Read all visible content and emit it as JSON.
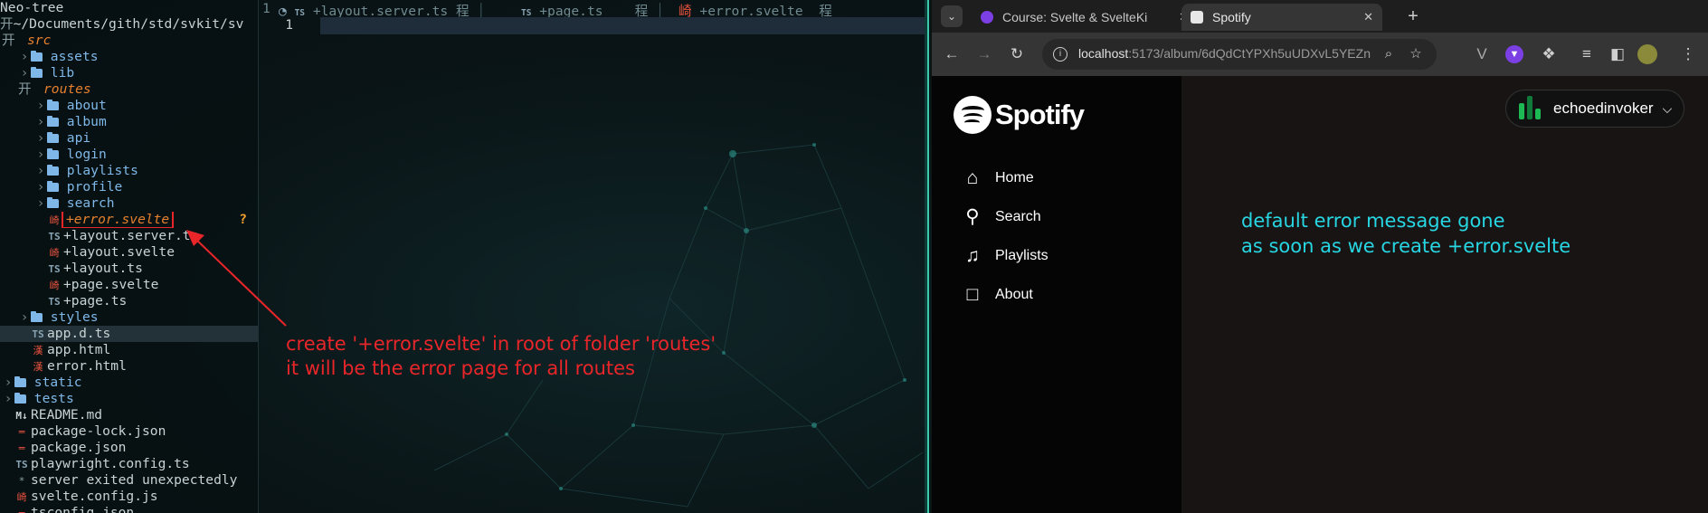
{
  "nvim": {
    "tree_title": "Neo-tree",
    "tree_path": "~/Documents/gith/std/svkit/sv",
    "tabline": {
      "line_number": "1",
      "tab1": "+layout.server.ts",
      "tab2": "+page.ts",
      "tab3": "+error.svelte",
      "tab_marker": "程"
    },
    "editor_line": "1",
    "tree": [
      {
        "label": "src",
        "kind": "open",
        "depth": 0
      },
      {
        "label": "assets",
        "kind": "folder",
        "depth": 1
      },
      {
        "label": "lib",
        "kind": "folder",
        "depth": 1
      },
      {
        "label": "routes",
        "kind": "open",
        "depth": 1
      },
      {
        "label": "about",
        "kind": "folder",
        "depth": 2
      },
      {
        "label": "album",
        "kind": "folder",
        "depth": 2
      },
      {
        "label": "api",
        "kind": "folder",
        "depth": 2
      },
      {
        "label": "login",
        "kind": "folder",
        "depth": 2
      },
      {
        "label": "playlists",
        "kind": "folder",
        "depth": 2
      },
      {
        "label": "profile",
        "kind": "folder",
        "depth": 2
      },
      {
        "label": "search",
        "kind": "folder",
        "depth": 2
      },
      {
        "label": "+error.svelte",
        "kind": "svelte-new",
        "depth": 2,
        "status": "?"
      },
      {
        "label": "+layout.server.ts",
        "kind": "ts",
        "depth": 2
      },
      {
        "label": "+layout.svelte",
        "kind": "svelte",
        "depth": 2
      },
      {
        "label": "+layout.ts",
        "kind": "ts",
        "depth": 2
      },
      {
        "label": "+page.svelte",
        "kind": "svelte",
        "depth": 2
      },
      {
        "label": "+page.ts",
        "kind": "ts",
        "depth": 2
      },
      {
        "label": "styles",
        "kind": "folder",
        "depth": 1
      },
      {
        "label": "app.d.ts",
        "kind": "ts-cursor",
        "depth": 1
      },
      {
        "label": "app.html",
        "kind": "html",
        "depth": 1
      },
      {
        "label": "error.html",
        "kind": "html",
        "depth": 1
      },
      {
        "label": "static",
        "kind": "folder",
        "depth": 0
      },
      {
        "label": "tests",
        "kind": "folder",
        "depth": 0
      },
      {
        "label": "README.md",
        "kind": "md",
        "depth": 0
      },
      {
        "label": "package-lock.json",
        "kind": "json",
        "depth": 0
      },
      {
        "label": "package.json",
        "kind": "json",
        "depth": 0
      },
      {
        "label": "playwright.config.ts",
        "kind": "ts",
        "depth": 0
      },
      {
        "label": "server exited unexpectedly",
        "kind": "note",
        "depth": 0
      },
      {
        "label": "svelte.config.js",
        "kind": "svelte",
        "depth": 0
      },
      {
        "label": "tsconfig.json",
        "kind": "json",
        "depth": 0
      }
    ]
  },
  "annotations": {
    "red_line1": "create '+error.svelte' in root of folder 'routes'",
    "red_line2": "it will be the error page for all routes",
    "cyan_line1": "default error message gone",
    "cyan_line2": "as soon as we create +error.svelte",
    "arrow_color": "#e8262a"
  },
  "browser": {
    "tabs": [
      {
        "title": "Course: Svelte & SvelteKi",
        "active": false,
        "fav_color": "#7b3fe4"
      },
      {
        "title": "Spotify",
        "active": true,
        "fav_color": "#e8e8e8"
      }
    ],
    "url_host": "localhost",
    "url_rest": ":5173/album/6dQdCtYPXh5uUDXvL5YEZn"
  },
  "spotify": {
    "logo_text": "Spotify",
    "nav": [
      {
        "label": "Home",
        "icon": "home-icon"
      },
      {
        "label": "Search",
        "icon": "search-icon"
      },
      {
        "label": "Playlists",
        "icon": "playlists-icon"
      },
      {
        "label": "About",
        "icon": "about-icon"
      }
    ],
    "username": "echoedinvoker",
    "accent": "#1db954"
  }
}
